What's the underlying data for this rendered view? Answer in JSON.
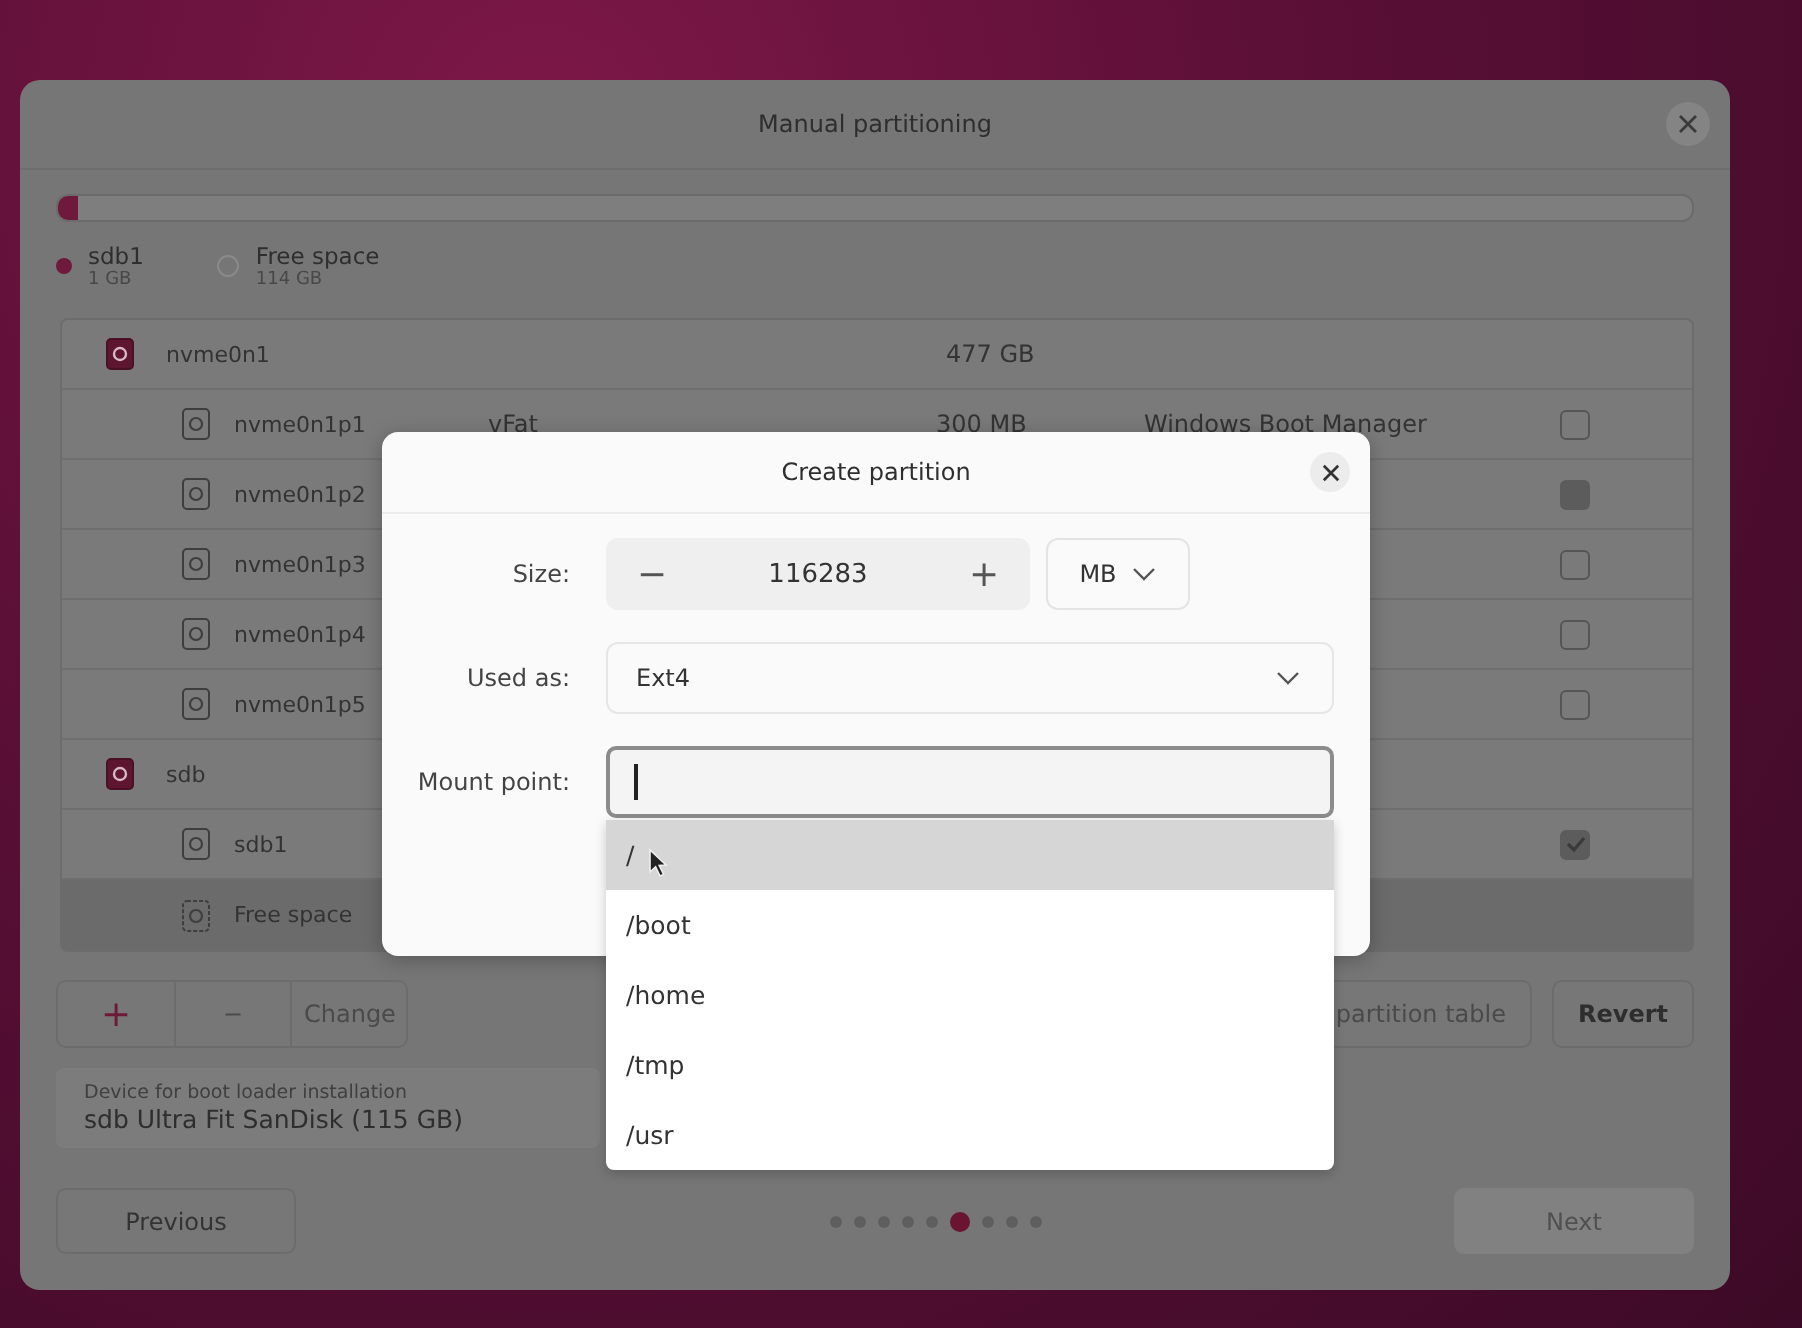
{
  "window": {
    "title": "Manual partitioning"
  },
  "partition_bar": {
    "segments": [
      {
        "color": "#6e1a3c",
        "level": 0.012
      }
    ]
  },
  "legend": [
    {
      "kind": "partition",
      "name": "sdb1",
      "size": "1 GB",
      "color": "#6e1a3c"
    },
    {
      "kind": "free",
      "name": "Free space",
      "size": "114 GB"
    }
  ],
  "disks": [
    {
      "name": "nvme0n1",
      "size": "477 GB",
      "children": [
        {
          "kind": "partition",
          "name": "nvme0n1p1",
          "type": "vFat",
          "size": "300 MB",
          "system": "Windows Boot Manager",
          "checked": false,
          "disabled": false,
          "selected": false
        },
        {
          "kind": "partition",
          "name": "nvme0n1p2",
          "checked": false,
          "disabled": true,
          "selected": false
        },
        {
          "kind": "partition",
          "name": "nvme0n1p3",
          "checked": false,
          "disabled": false,
          "selected": false
        },
        {
          "kind": "partition",
          "name": "nvme0n1p4",
          "checked": false,
          "disabled": false,
          "selected": false
        },
        {
          "kind": "partition",
          "name": "nvme0n1p5",
          "checked": false,
          "disabled": false,
          "selected": false
        }
      ]
    },
    {
      "name": "sdb",
      "children": [
        {
          "kind": "partition",
          "name": "sdb1",
          "checked": true,
          "disabled": true,
          "selected": false
        },
        {
          "kind": "free",
          "name": "Free space",
          "selected": true
        }
      ]
    }
  ],
  "partition_buttons": [
    {
      "label": "+",
      "disabled": false
    },
    {
      "label": "−",
      "disabled": true
    },
    {
      "label": "Change",
      "disabled": true
    }
  ],
  "table_buttons": [
    {
      "label": "partition table",
      "disabled": true
    },
    {
      "label": "Revert",
      "disabled": false
    }
  ],
  "boot_loader": {
    "label": "Device for boot loader installation",
    "value": "sdb Ultra Fit SanDisk (115 GB)"
  },
  "pages": [
    {
      "selected": false
    },
    {
      "selected": false
    },
    {
      "selected": false
    },
    {
      "selected": false
    },
    {
      "selected": false
    },
    {
      "selected": true
    },
    {
      "selected": false
    },
    {
      "selected": false
    },
    {
      "selected": false
    }
  ],
  "previous_button": {
    "label": "Previous",
    "disabled": false
  },
  "next_button": {
    "label": "Next",
    "disabled": true
  },
  "dialog": {
    "title": "Create partition",
    "size": {
      "label": "Size:",
      "decrement": "−",
      "value": "116283",
      "increment": "+",
      "unit": "MB"
    },
    "used_as": {
      "label": "Used as:",
      "value": "Ext4"
    },
    "mount_point": {
      "label": "Mount point:",
      "focused": true
    },
    "options": [
      {
        "label": "/",
        "selected": true
      },
      {
        "label": "/boot",
        "selected": false
      },
      {
        "label": "/home",
        "selected": false
      },
      {
        "label": "/tmp",
        "selected": false
      },
      {
        "label": "/usr",
        "selected": false
      }
    ]
  }
}
